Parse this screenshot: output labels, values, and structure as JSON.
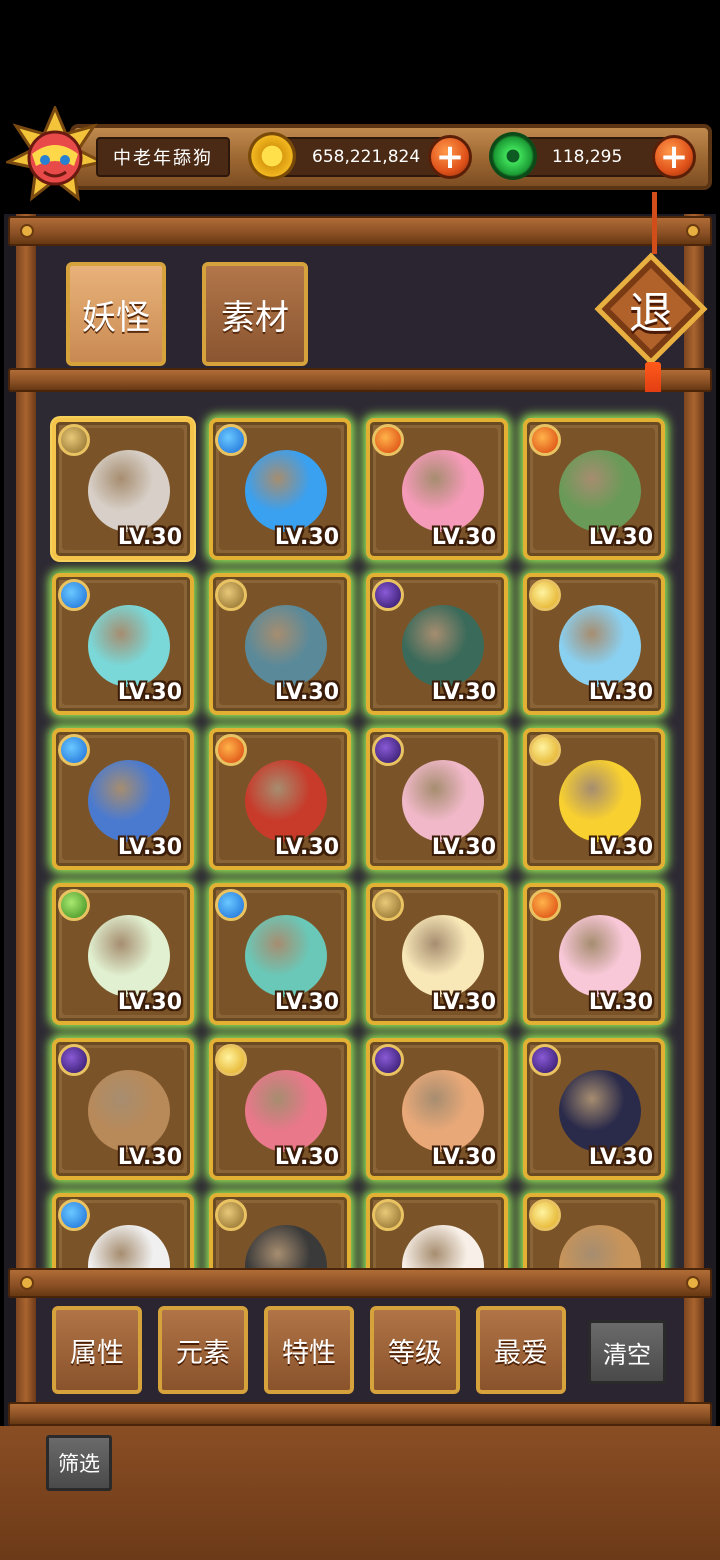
{
  "player": {
    "name": "中老年舔狗",
    "coins": "658,221,824",
    "gems": "118,295"
  },
  "tabs": [
    {
      "label": "妖怪",
      "active": true
    },
    {
      "label": "素材",
      "active": false
    }
  ],
  "exit_label": "退",
  "level_text": "LV.30",
  "cards": [
    {
      "element": "earth",
      "selected": true,
      "color": "#d8d0c8"
    },
    {
      "element": "water",
      "color": "#3aa0f0"
    },
    {
      "element": "fire",
      "color": "#f59ab8"
    },
    {
      "element": "fire",
      "color": "#6a9a58"
    },
    {
      "element": "water",
      "color": "#7ad8d8"
    },
    {
      "element": "earth",
      "color": "#5a8a9a"
    },
    {
      "element": "dark",
      "color": "#3a6a5a"
    },
    {
      "element": "light",
      "color": "#8ad0f0"
    },
    {
      "element": "water",
      "color": "#4a7ad0"
    },
    {
      "element": "fire",
      "color": "#c83a2a"
    },
    {
      "element": "dark",
      "color": "#f0b8c8"
    },
    {
      "element": "light",
      "color": "#f8d030"
    },
    {
      "element": "grass",
      "color": "#e0f0d0"
    },
    {
      "element": "water",
      "color": "#6ac8b8"
    },
    {
      "element": "earth",
      "color": "#f8e8b8"
    },
    {
      "element": "fire",
      "color": "#f8c8d8"
    },
    {
      "element": "dark",
      "color": "#b88a5a"
    },
    {
      "element": "light",
      "color": "#e8788a"
    },
    {
      "element": "dark",
      "color": "#e8a878"
    },
    {
      "element": "dark",
      "color": "#2a2a4a"
    },
    {
      "element": "water",
      "color": "#f0f0f0"
    },
    {
      "element": "earth",
      "color": "#3a3a3a"
    },
    {
      "element": "earth",
      "color": "#f8f0e8"
    },
    {
      "element": "light",
      "color": "#c8945a"
    }
  ],
  "filters": [
    "属性",
    "元素",
    "特性",
    "等级",
    "最爱"
  ],
  "clear_label": "清空",
  "screen_label": "筛选",
  "colors": {
    "wood": "#8a5530",
    "gold_border": "#d6a23c",
    "glow": "#9cf55a"
  }
}
